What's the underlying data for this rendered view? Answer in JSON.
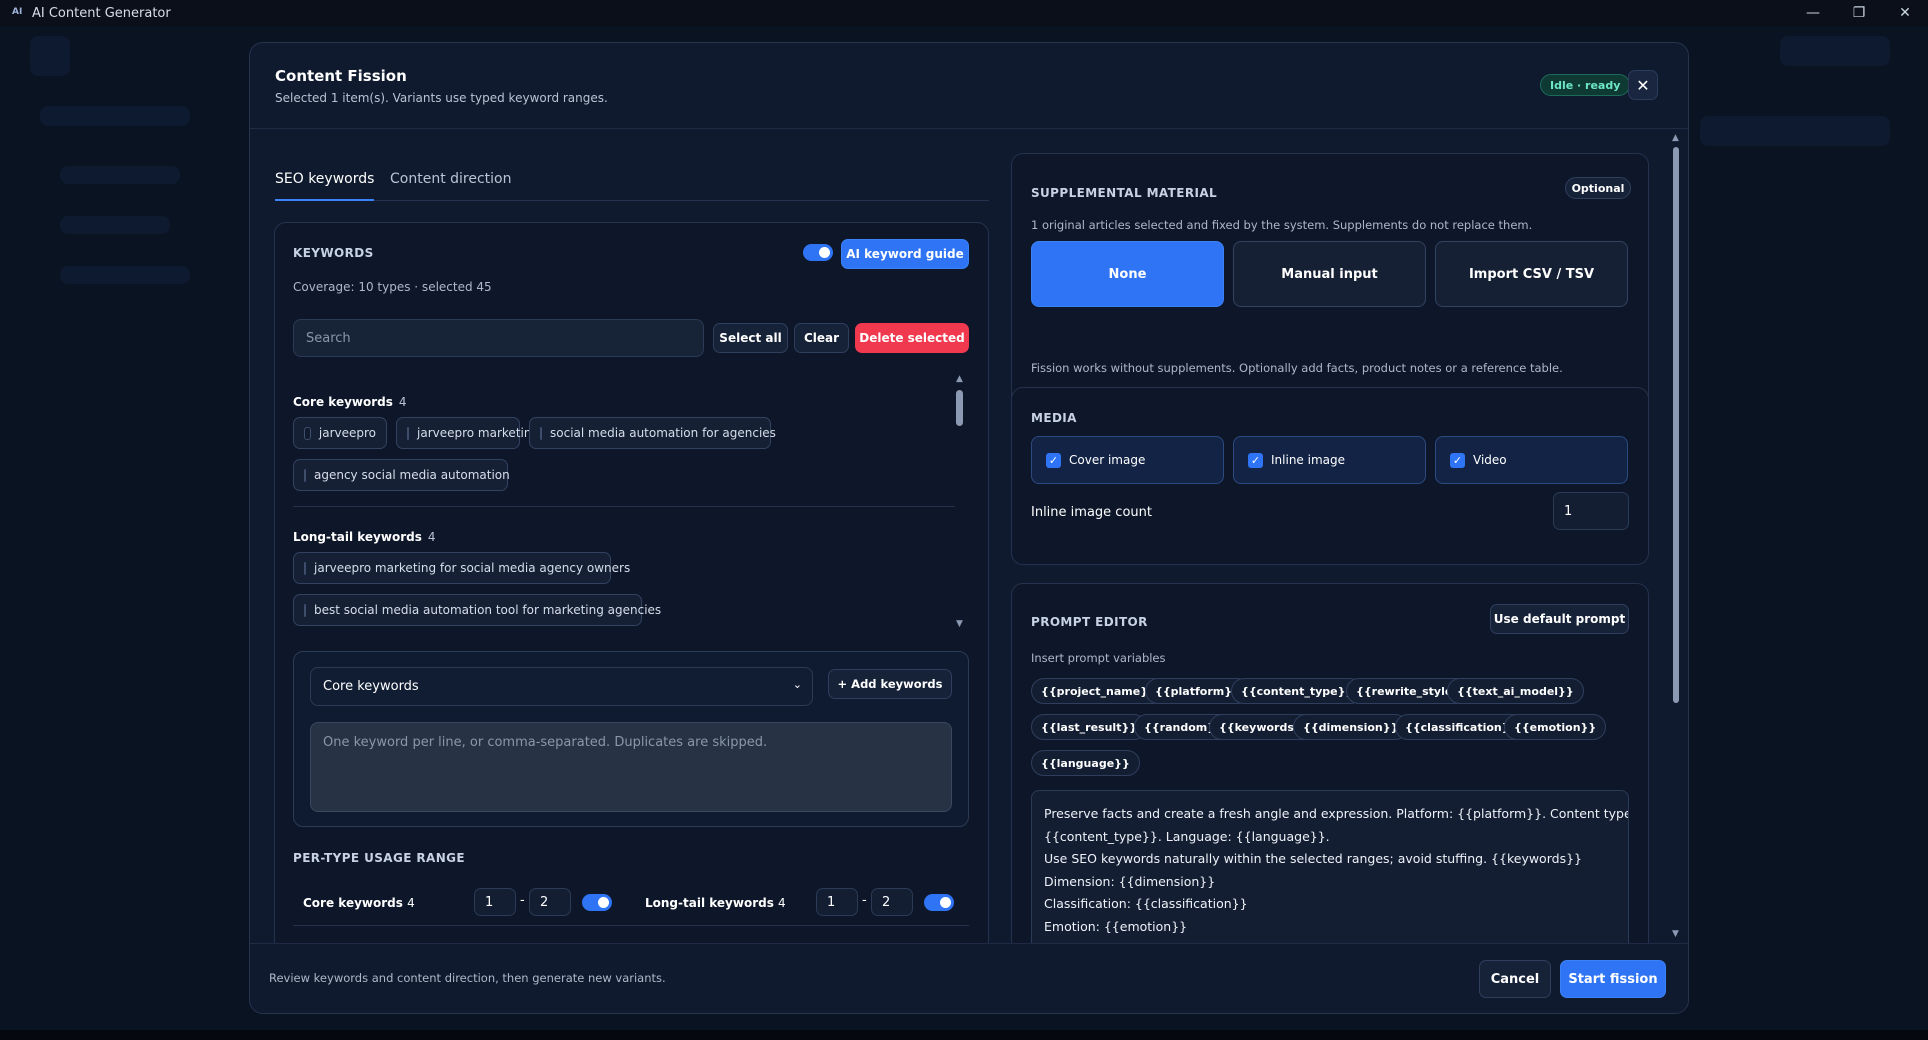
{
  "window": {
    "title": "AI Content Generator",
    "app_icon": "AI"
  },
  "modal": {
    "title": "Content Fission",
    "subtitle": "Selected 1 item(s). Variants use typed keyword ranges.",
    "status": "Idle · ready"
  },
  "tabs": [
    {
      "label": "SEO keywords",
      "active": true
    },
    {
      "label": "Content direction",
      "active": false
    }
  ],
  "keywords": {
    "title": "KEYWORDS",
    "guide_label": "AI keyword guide",
    "coverage": "Coverage: 10 types · selected 45",
    "search_placeholder": "Search",
    "select_all": "Select all",
    "clear": "Clear",
    "delete_selected": "Delete selected",
    "groups": [
      {
        "name": "Core keywords",
        "count": "4",
        "items": [
          "jarveepro",
          "jarveepro marketing",
          "social media automation for agencies",
          "agency social media automation"
        ]
      },
      {
        "name": "Long-tail keywords",
        "count": "4",
        "items": [
          "jarveepro marketing for social media agency owners",
          "best social media automation tool for marketing agencies"
        ]
      }
    ],
    "add_type_selected": "Core keywords",
    "add_button": "+ Add keywords",
    "textarea_placeholder": "One keyword per line, or comma-separated. Duplicates are skipped."
  },
  "usage": {
    "title": "PER-TYPE USAGE RANGE",
    "rows": [
      {
        "label": "Core keywords",
        "count": "4",
        "min": "1",
        "max": "2",
        "dash": "-"
      },
      {
        "label": "Long-tail keywords",
        "count": "4",
        "min": "1",
        "max": "2",
        "dash": "-"
      }
    ]
  },
  "supplemental": {
    "title": "SUPPLEMENTAL MATERIAL",
    "badge": "Optional",
    "desc": "1 original articles selected and fixed by the system. Supplements do not replace them.",
    "options": [
      "None",
      "Manual input",
      "Import CSV / TSV"
    ],
    "selected": "None",
    "note": "Fission works without supplements. Optionally add facts, product notes or a reference table."
  },
  "media": {
    "title": "MEDIA",
    "items": [
      {
        "label": "Cover image",
        "checked": true
      },
      {
        "label": "Inline image",
        "checked": true
      },
      {
        "label": "Video",
        "checked": true
      }
    ],
    "count_label": "Inline image count",
    "count_value": "1"
  },
  "prompt": {
    "title": "PROMPT EDITOR",
    "default_button": "Use default prompt",
    "vars_label": "Insert prompt variables",
    "variables": [
      "{{project_name}}",
      "{{platform}}",
      "{{content_type}}",
      "{{rewrite_style}}",
      "{{text_ai_model}}",
      "{{last_result}}",
      "{{random}}",
      "{{keywords}}",
      "{{dimension}}",
      "{{classification}}",
      "{{emotion}}",
      "{{language}}"
    ],
    "lines": [
      "Preserve facts and create a fresh angle and expression. Platform: {{platform}}. Content type:",
      "{{content_type}}. Language: {{language}}.",
      "Use SEO keywords naturally within the selected ranges; avoid stuffing. {{keywords}}",
      "Dimension: {{dimension}}",
      "Classification: {{classification}}",
      "Emotion: {{emotion}}"
    ]
  },
  "footer": {
    "hint": "Review keywords and content direction, then generate new variants.",
    "cancel": "Cancel",
    "start": "Start fission"
  },
  "colors": {
    "accent": "#2f74f5",
    "danger": "#f0384f",
    "status": "#6ee7c8",
    "background": "#0f1a2e"
  }
}
